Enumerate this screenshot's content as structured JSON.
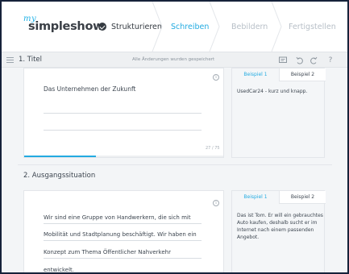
{
  "header": {
    "logo_prefix": "my",
    "logo_name": "simpleshow",
    "steps": [
      {
        "label": "Strukturieren",
        "state": "done"
      },
      {
        "label": "Schreiben",
        "state": "active"
      },
      {
        "label": "Bebildern",
        "state": "inactive"
      },
      {
        "label": "Fertigstellen",
        "state": "inactive"
      }
    ]
  },
  "toolbar": {
    "section_title": "1. Titel",
    "save_status": "Alle Änderungen wurden gespeichert",
    "icons": [
      "comment-icon",
      "undo-icon",
      "redo-icon",
      "help-icon"
    ],
    "help_glyph": "?"
  },
  "sections": [
    {
      "title": "",
      "field_value": "Das Unternehmen der Zukunft",
      "char_count": "27 / 75",
      "progress_fraction": 0.36,
      "examples": {
        "tabs": [
          "Beispiel 1",
          "Beispiel 2"
        ],
        "text": "UsedCar24 - kurz und knapp."
      }
    },
    {
      "title": "2. Ausgangssituation",
      "field_lines": [
        "Wir sind eine Gruppe von Handwerkern, die sich mit",
        "Mobilität und Stadtplanung beschäftigt. Wir haben ein",
        "Konzept zum Thema Öffentlicher Nahverkehr",
        "entwickelt."
      ],
      "examples": {
        "tabs": [
          "Beispiel 1",
          "Beispiel 2"
        ],
        "text_lines": [
          "Das ist Tom. Er will ein gebrauchtes",
          "Auto kaufen, deshalb sucht er im",
          "Internet nach einem passenden",
          "Angebot."
        ]
      }
    }
  ],
  "colors": {
    "accent": "#23abe1",
    "frame": "#16223a",
    "background": "#f3f5f7"
  }
}
